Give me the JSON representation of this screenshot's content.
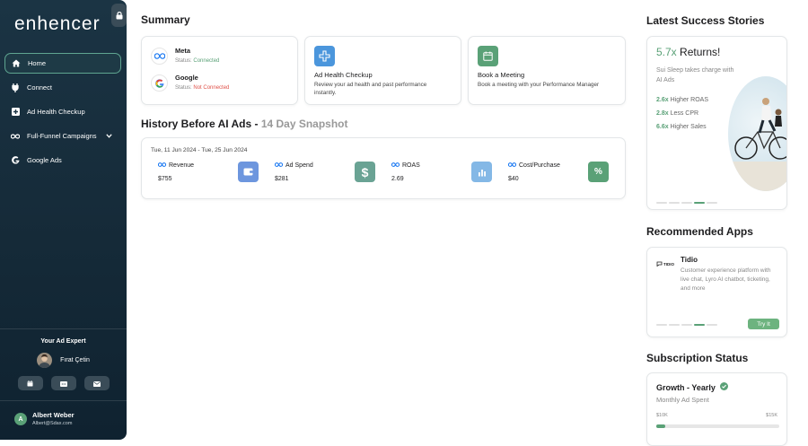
{
  "app": {
    "logo": "enhencer"
  },
  "sidebar": {
    "items": [
      {
        "label": "Home"
      },
      {
        "label": "Connect"
      },
      {
        "label": "Ad Health Checkup"
      },
      {
        "label": "Full-Funnel Campaigns"
      },
      {
        "label": "Google Ads"
      }
    ],
    "expert_title": "Your Ad Expert",
    "expert_name": "Fırat Çetin",
    "user_initial": "A",
    "user_name": "Albert Weber",
    "user_email": "Albert@Sdax.com"
  },
  "summary": {
    "title": "Summary",
    "platforms": [
      {
        "name": "Meta",
        "status_prefix": "Status:",
        "status": "Connected",
        "status_color": "#5aa177"
      },
      {
        "name": "Google",
        "status_prefix": "Status:",
        "status": "Not Connected",
        "status_color": "#e0524a"
      }
    ],
    "health": {
      "title": "Ad Health Checkup",
      "desc": "Review your ad health and past performance instantly."
    },
    "meeting": {
      "title": "Book a Meeting",
      "desc": "Book a meeting with your Performance Manager"
    }
  },
  "history": {
    "title": "History Before AI Ads -",
    "subtitle": "14 Day Snapshot",
    "date_range": "Tue, 11 Jun 2024 - Tue, 25 Jun 2024",
    "metrics": [
      {
        "label": "Revenue",
        "value": "$755",
        "icon": "wallet-icon",
        "color": "#6d96de"
      },
      {
        "label": "Ad Spend",
        "value": "$281",
        "icon": "dollar-icon",
        "color": "#6aa394"
      },
      {
        "label": "ROAS",
        "value": "2.69",
        "icon": "bar-chart-icon",
        "color": "#84b8e6"
      },
      {
        "label": "Cost/Purchase",
        "value": "$40",
        "icon": "percent-icon",
        "color": "#5aa177"
      }
    ]
  },
  "stories": {
    "title": "Latest Success Stories",
    "headline_num": "5.7x",
    "headline_text": "Returns!",
    "desc": "Sui Sleep takes charge with AI Ads",
    "stats": [
      {
        "num": "2.6x",
        "text": "Higher ROAS"
      },
      {
        "num": "2.8x",
        "text": "Less CPR"
      },
      {
        "num": "6.6x",
        "text": "Higher Sales"
      }
    ]
  },
  "apps": {
    "title": "Recommended Apps",
    "name": "Tidio",
    "logo_text": "TIDIO",
    "desc": "Customer experience platform with live chat, Lyro AI chatbot, ticketing, and more",
    "button": "Try It"
  },
  "subscription": {
    "title": "Subscription Status",
    "plan": "Growth - Yearly",
    "label": "Monthly Ad Spent",
    "min": "$10K",
    "max": "$15K",
    "progress": 0.07
  },
  "colors": {
    "accent": "#5aa177",
    "sidebar": "#1b3444"
  }
}
